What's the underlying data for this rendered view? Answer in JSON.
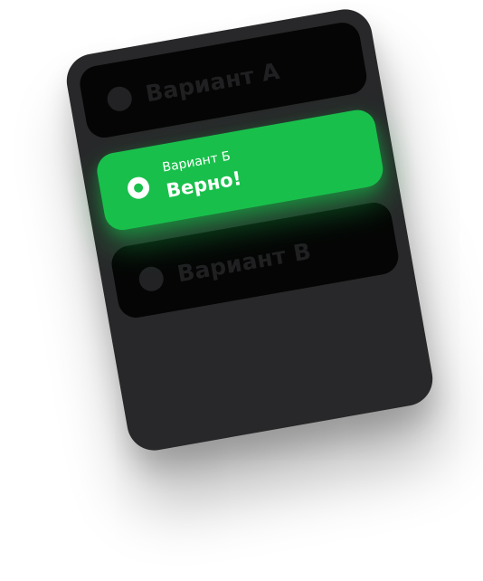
{
  "quiz": {
    "options": [
      {
        "label": "Вариант А",
        "state": "unselected"
      },
      {
        "label": "Вариант Б",
        "state": "correct",
        "result": "Верно!"
      },
      {
        "label": "Вариант В",
        "state": "unselected"
      }
    ]
  },
  "colors": {
    "card_background": "#28282a",
    "option_background": "#050505",
    "correct_accent": "#18c04b",
    "page_background": "#ffffff"
  },
  "icons": {
    "unselected": "radio-empty-icon",
    "selected": "radio-selected-icon"
  }
}
